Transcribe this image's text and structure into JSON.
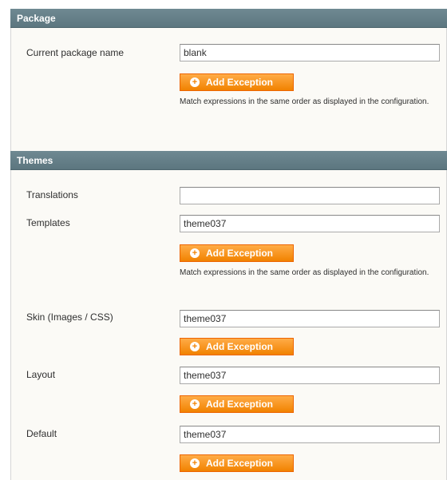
{
  "package": {
    "header": "Package",
    "current_package_label": "Current package name",
    "current_package_value": "blank",
    "add_exception_label": "Add Exception",
    "note": "Match expressions in the same order as displayed in the configuration."
  },
  "themes": {
    "header": "Themes",
    "translations_label": "Translations",
    "translations_value": "",
    "templates_label": "Templates",
    "templates_value": "theme037",
    "templates_add_exception_label": "Add Exception",
    "templates_note": "Match expressions in the same order as displayed in the configuration.",
    "skin_label": "Skin (Images / CSS)",
    "skin_value": "theme037",
    "skin_add_exception_label": "Add Exception",
    "layout_label": "Layout",
    "layout_value": "theme037",
    "layout_add_exception_label": "Add Exception",
    "default_label": "Default",
    "default_value": "theme037",
    "default_add_exception_label": "Add Exception"
  },
  "colors": {
    "header_bg": "#6f8992",
    "button_orange": "#f18200",
    "fieldset_bg": "#fbfaf6"
  },
  "icons": {
    "add": "plus-circle-icon"
  }
}
